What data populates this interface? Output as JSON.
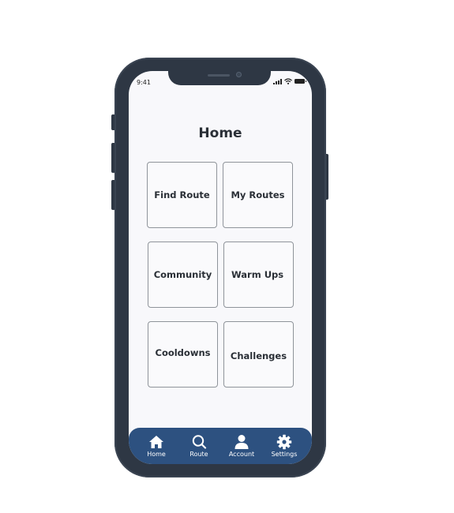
{
  "status_bar": {
    "time": "9:41"
  },
  "header": {
    "title": "Home"
  },
  "tiles": [
    {
      "label": "Find Route"
    },
    {
      "label": "My Routes"
    },
    {
      "label": "Community"
    },
    {
      "label": "Warm Ups"
    },
    {
      "label": "Cooldowns"
    },
    {
      "label": "Challenges"
    }
  ],
  "tab_bar": {
    "items": [
      {
        "label": "Home",
        "icon": "home-icon"
      },
      {
        "label": "Route",
        "icon": "search-icon"
      },
      {
        "label": "Account",
        "icon": "person-icon"
      },
      {
        "label": "Settings",
        "icon": "gear-icon"
      }
    ]
  },
  "colors": {
    "phone_frame": "#2e3744",
    "tab_bar": "#2d5180",
    "screen_bg": "#f8f8fb",
    "title_text": "#2a2f36"
  }
}
